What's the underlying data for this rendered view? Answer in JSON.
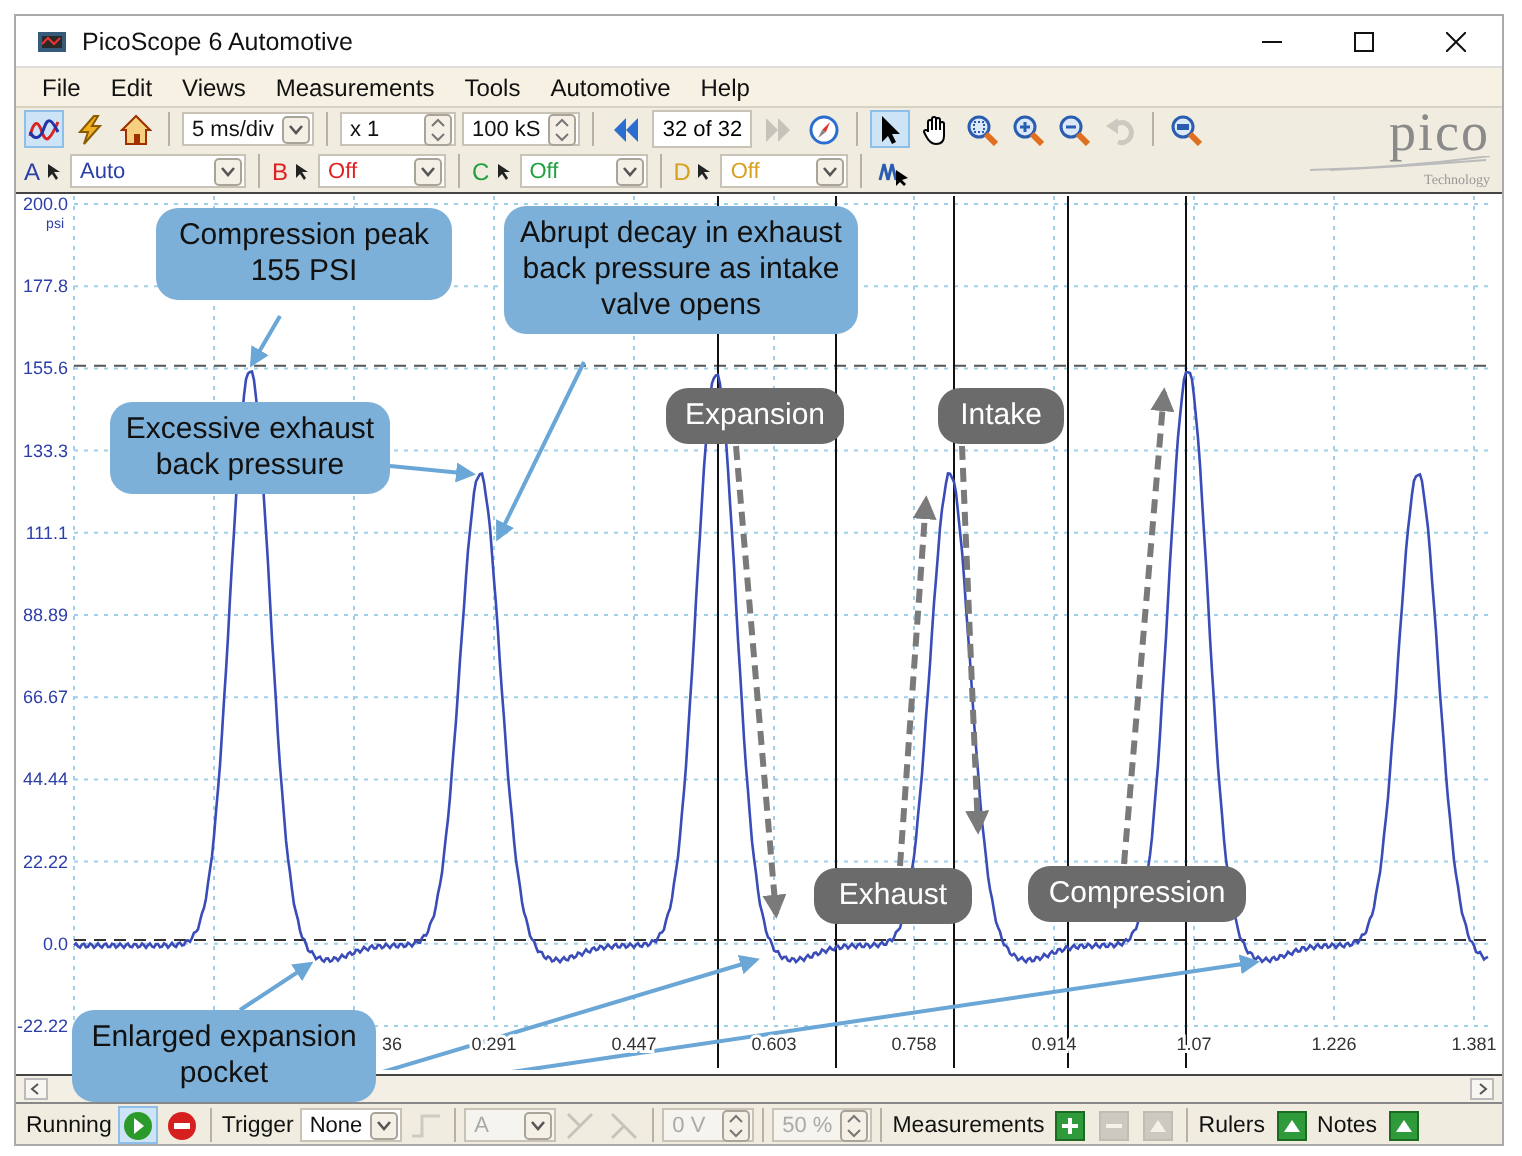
{
  "window": {
    "title": "PicoScope 6 Automotive"
  },
  "menu": [
    "File",
    "Edit",
    "Views",
    "Measurements",
    "Tools",
    "Automotive",
    "Help"
  ],
  "toolbar": [
    {
      "kind": "scope",
      "selected": true,
      "disabled": false
    },
    {
      "kind": "probe",
      "selected": false,
      "disabled": false
    },
    {
      "kind": "home",
      "selected": false,
      "disabled": false
    },
    {
      "kind": "separator"
    },
    {
      "kind": "dropdown",
      "value": "5 ms/div",
      "disabled": false
    },
    {
      "kind": "separator"
    },
    {
      "kind": "spinner",
      "value": "x 1",
      "disabled": false
    },
    {
      "kind": "spinner",
      "value": "100 kS",
      "disabled": false
    },
    {
      "kind": "separator"
    },
    {
      "kind": "first",
      "selected": false,
      "disabled": false
    },
    {
      "kind": "counter",
      "value": "32 of 32"
    },
    {
      "kind": "next",
      "selected": false,
      "disabled": true
    },
    {
      "kind": "compass",
      "selected": false,
      "disabled": false
    },
    {
      "kind": "separator"
    },
    {
      "kind": "pointer",
      "selected": true,
      "disabled": false
    },
    {
      "kind": "hand",
      "selected": false,
      "disabled": false
    },
    {
      "kind": "zoomarea",
      "selected": false,
      "disabled": false
    },
    {
      "kind": "zoomin",
      "selected": false,
      "disabled": false
    },
    {
      "kind": "zoomout",
      "selected": false,
      "disabled": false
    },
    {
      "kind": "undo",
      "selected": false,
      "disabled": true
    },
    {
      "kind": "separator"
    },
    {
      "kind": "zoomfit",
      "selected": false,
      "disabled": false
    }
  ],
  "logo": {
    "name": "pico",
    "tagline": "Technology"
  },
  "channel_bar": [
    {
      "kind": "channel",
      "letter": "A",
      "value": "Auto",
      "color": "#2c3ea8"
    },
    {
      "kind": "separator"
    },
    {
      "kind": "channel",
      "letter": "B",
      "value": "Off",
      "color": "#e02020"
    },
    {
      "kind": "separator"
    },
    {
      "kind": "channel",
      "letter": "C",
      "value": "Off",
      "color": "#20a040"
    },
    {
      "kind": "separator"
    },
    {
      "kind": "channel",
      "letter": "D",
      "value": "Off",
      "color": "#d8a020"
    },
    {
      "kind": "separator"
    },
    {
      "kind": "autoset",
      "selected": false,
      "disabled": false
    }
  ],
  "plot": {
    "unit": "psi",
    "y_ticks": [
      "200.0",
      "177.8",
      "155.6",
      "133.3",
      "111.1",
      "88.89",
      "66.67",
      "44.44",
      "22.22",
      "0.0",
      "-22.22"
    ],
    "x_ticks": [
      "36",
      "0.291",
      "0.447",
      "0.603",
      "0.758",
      "0.914",
      "1.07",
      "1.226",
      "1.381"
    ],
    "callouts": [
      {
        "kind": "note",
        "text": "Compression peak 155 PSI"
      },
      {
        "kind": "note",
        "text": "Abrupt decay in exhaust back pressure as intake valve opens"
      },
      {
        "kind": "phase",
        "text": "Expansion"
      },
      {
        "kind": "phase",
        "text": "Intake"
      },
      {
        "kind": "note",
        "text": "Excessive exhaust back pressure"
      },
      {
        "kind": "phase",
        "text": "Exhaust"
      },
      {
        "kind": "phase",
        "text": "Compression"
      },
      {
        "kind": "note",
        "text": "Enlarged expansion pocket"
      }
    ]
  },
  "status_bar": [
    {
      "kind": "label",
      "text": "Running"
    },
    {
      "kind": "start",
      "selected": true,
      "disabled": false
    },
    {
      "kind": "stop",
      "selected": false,
      "disabled": false
    },
    {
      "kind": "separator"
    },
    {
      "kind": "label",
      "text": "Trigger"
    },
    {
      "kind": "dropdown",
      "value": "None",
      "disabled": false
    },
    {
      "kind": "edge",
      "selected": false,
      "disabled": true
    },
    {
      "kind": "separator"
    },
    {
      "kind": "dropdown",
      "value": "A",
      "disabled": true
    },
    {
      "kind": "rising",
      "selected": false,
      "disabled": true
    },
    {
      "kind": "falling",
      "selected": false,
      "disabled": true
    },
    {
      "kind": "separator"
    },
    {
      "kind": "spinner",
      "value": "0 V",
      "disabled": true
    },
    {
      "kind": "separator"
    },
    {
      "kind": "spinner",
      "value": "50 %",
      "disabled": true
    },
    {
      "kind": "separator"
    },
    {
      "kind": "label",
      "text": "Measurements"
    },
    {
      "kind": "add",
      "selected": false,
      "disabled": false
    },
    {
      "kind": "remove",
      "selected": false,
      "disabled": true
    },
    {
      "kind": "edit",
      "selected": false,
      "disabled": true
    },
    {
      "kind": "separator"
    },
    {
      "kind": "label",
      "text": "Rulers"
    },
    {
      "kind": "rulers",
      "selected": false,
      "disabled": false
    },
    {
      "kind": "label",
      "text": "Notes"
    },
    {
      "kind": "notes",
      "selected": false,
      "disabled": false
    }
  ]
}
